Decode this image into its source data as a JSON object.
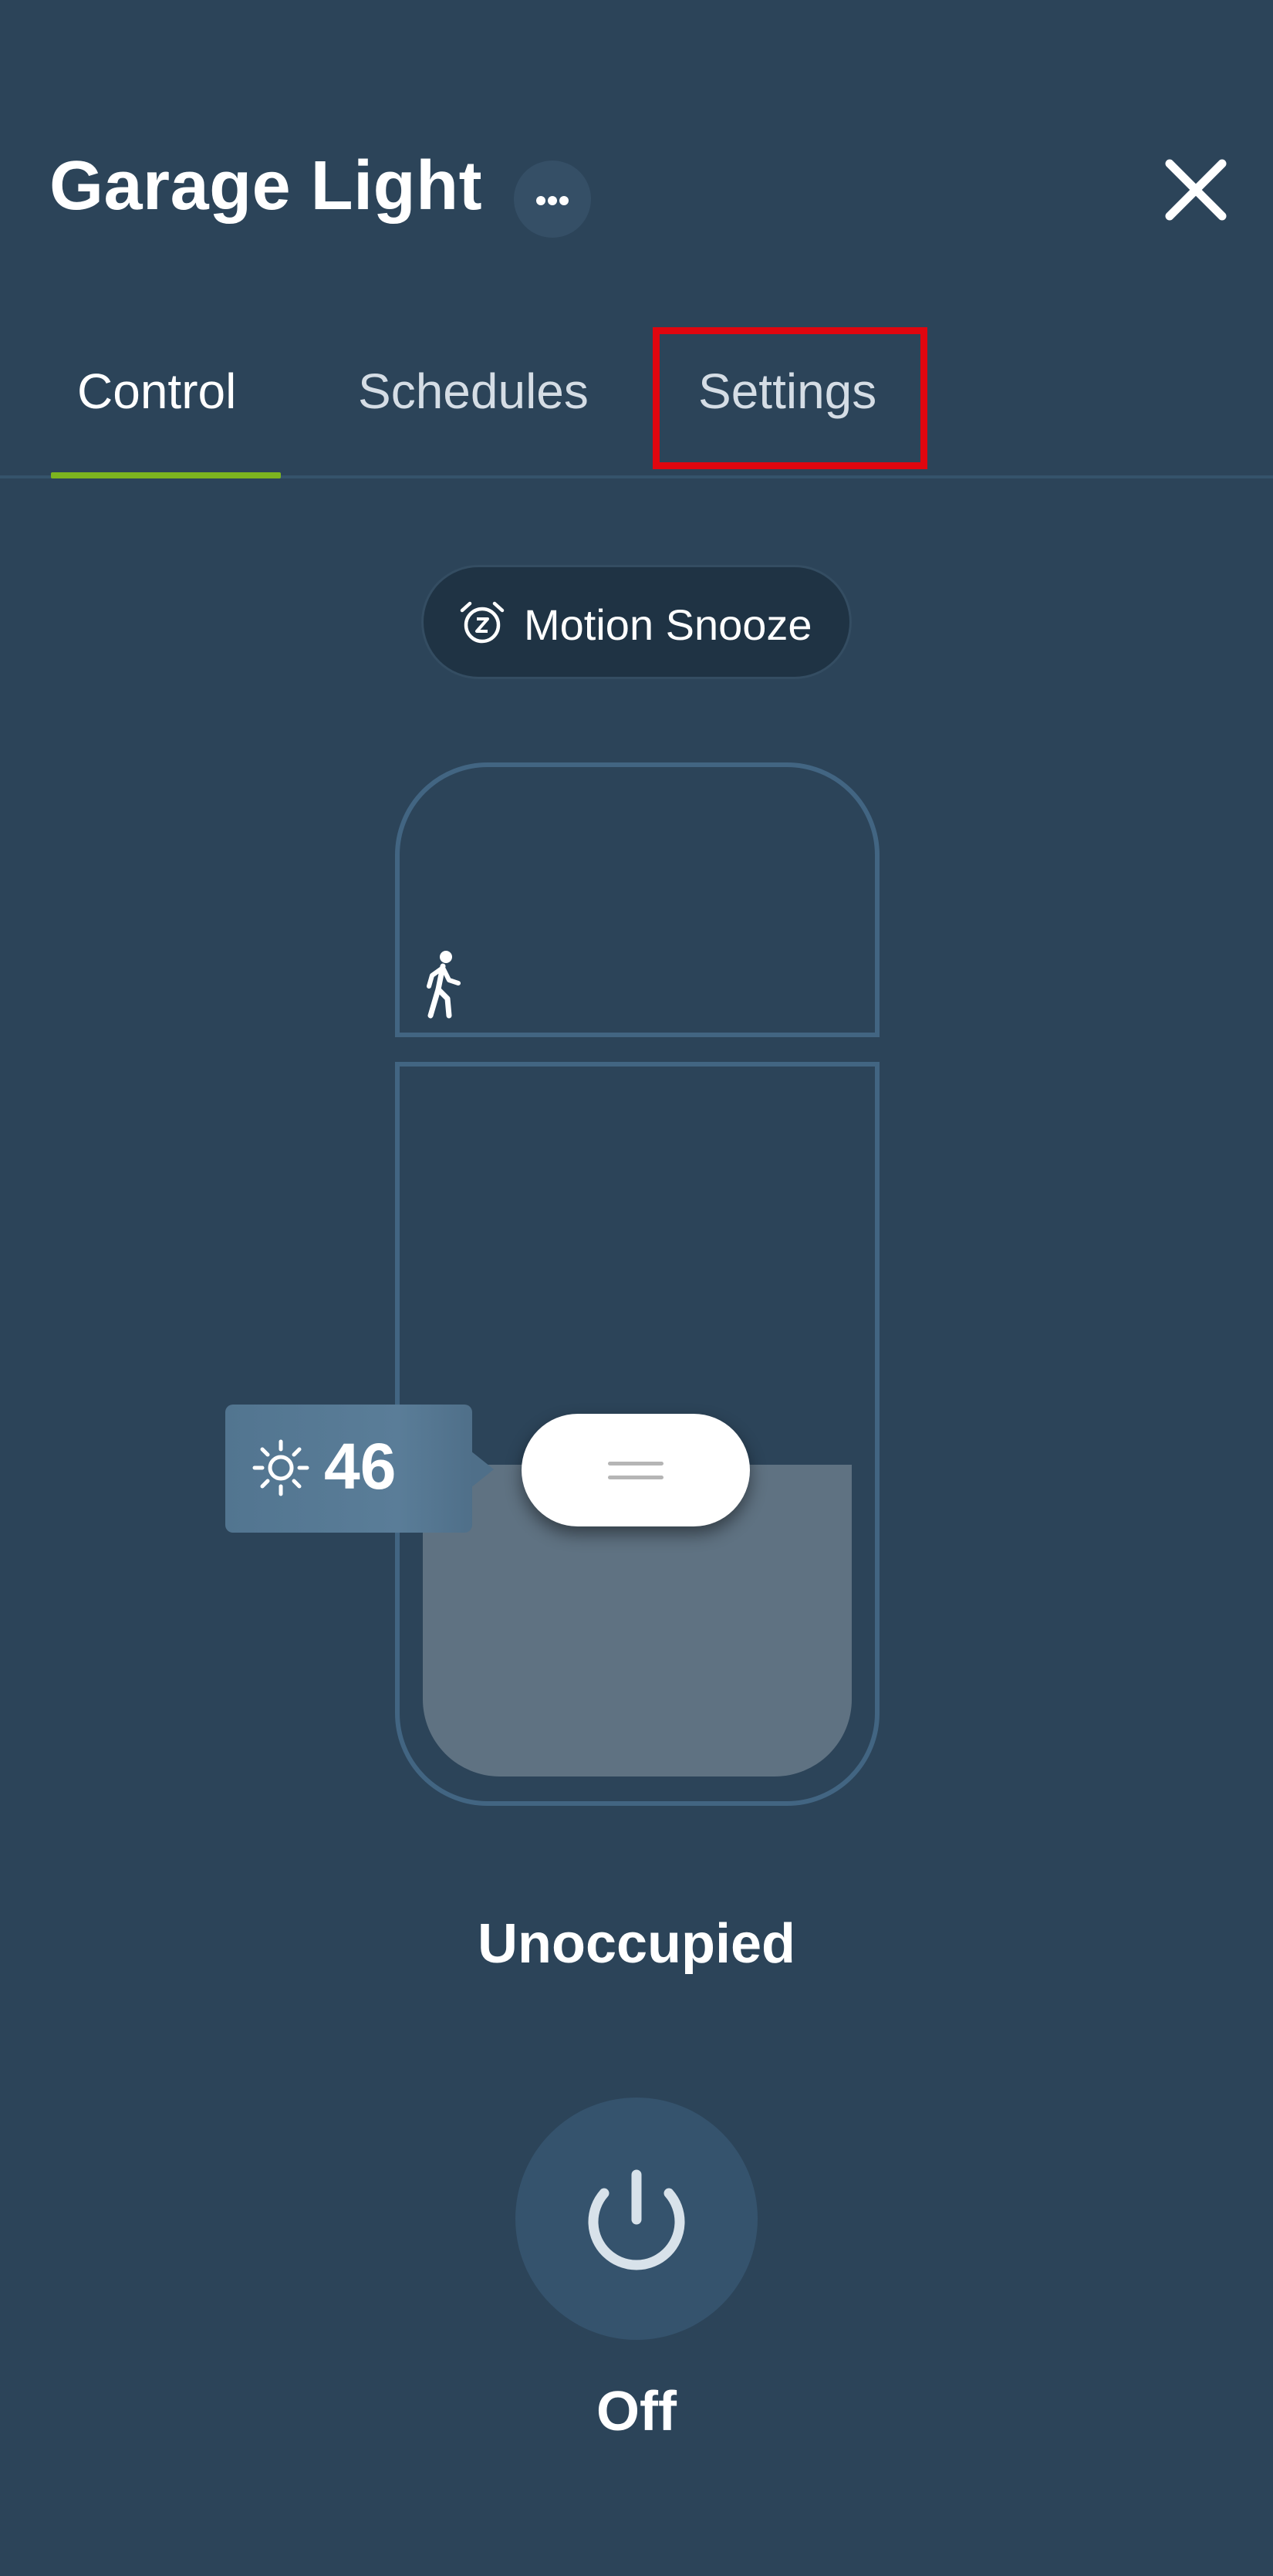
{
  "header": {
    "title": "Garage Light",
    "more_icon": "ellipsis-icon",
    "close_icon": "close-icon"
  },
  "tabs": [
    {
      "label": "Control",
      "active": true
    },
    {
      "label": "Schedules",
      "active": false
    },
    {
      "label": "Settings",
      "active": false,
      "highlighted": true
    }
  ],
  "motion_snooze": {
    "label": "Motion Snooze",
    "icon": "alarm-clock-snooze-icon"
  },
  "slider": {
    "motion_icon": "walking-person-icon",
    "brightness_icon": "sun-icon",
    "brightness": "46"
  },
  "status": {
    "occupancy": "Unoccupied"
  },
  "power": {
    "icon": "power-icon",
    "label": "Off"
  },
  "colors": {
    "background": "#2c4459",
    "tab_indicator": "#7db51f",
    "highlight_box": "#e0060f"
  }
}
